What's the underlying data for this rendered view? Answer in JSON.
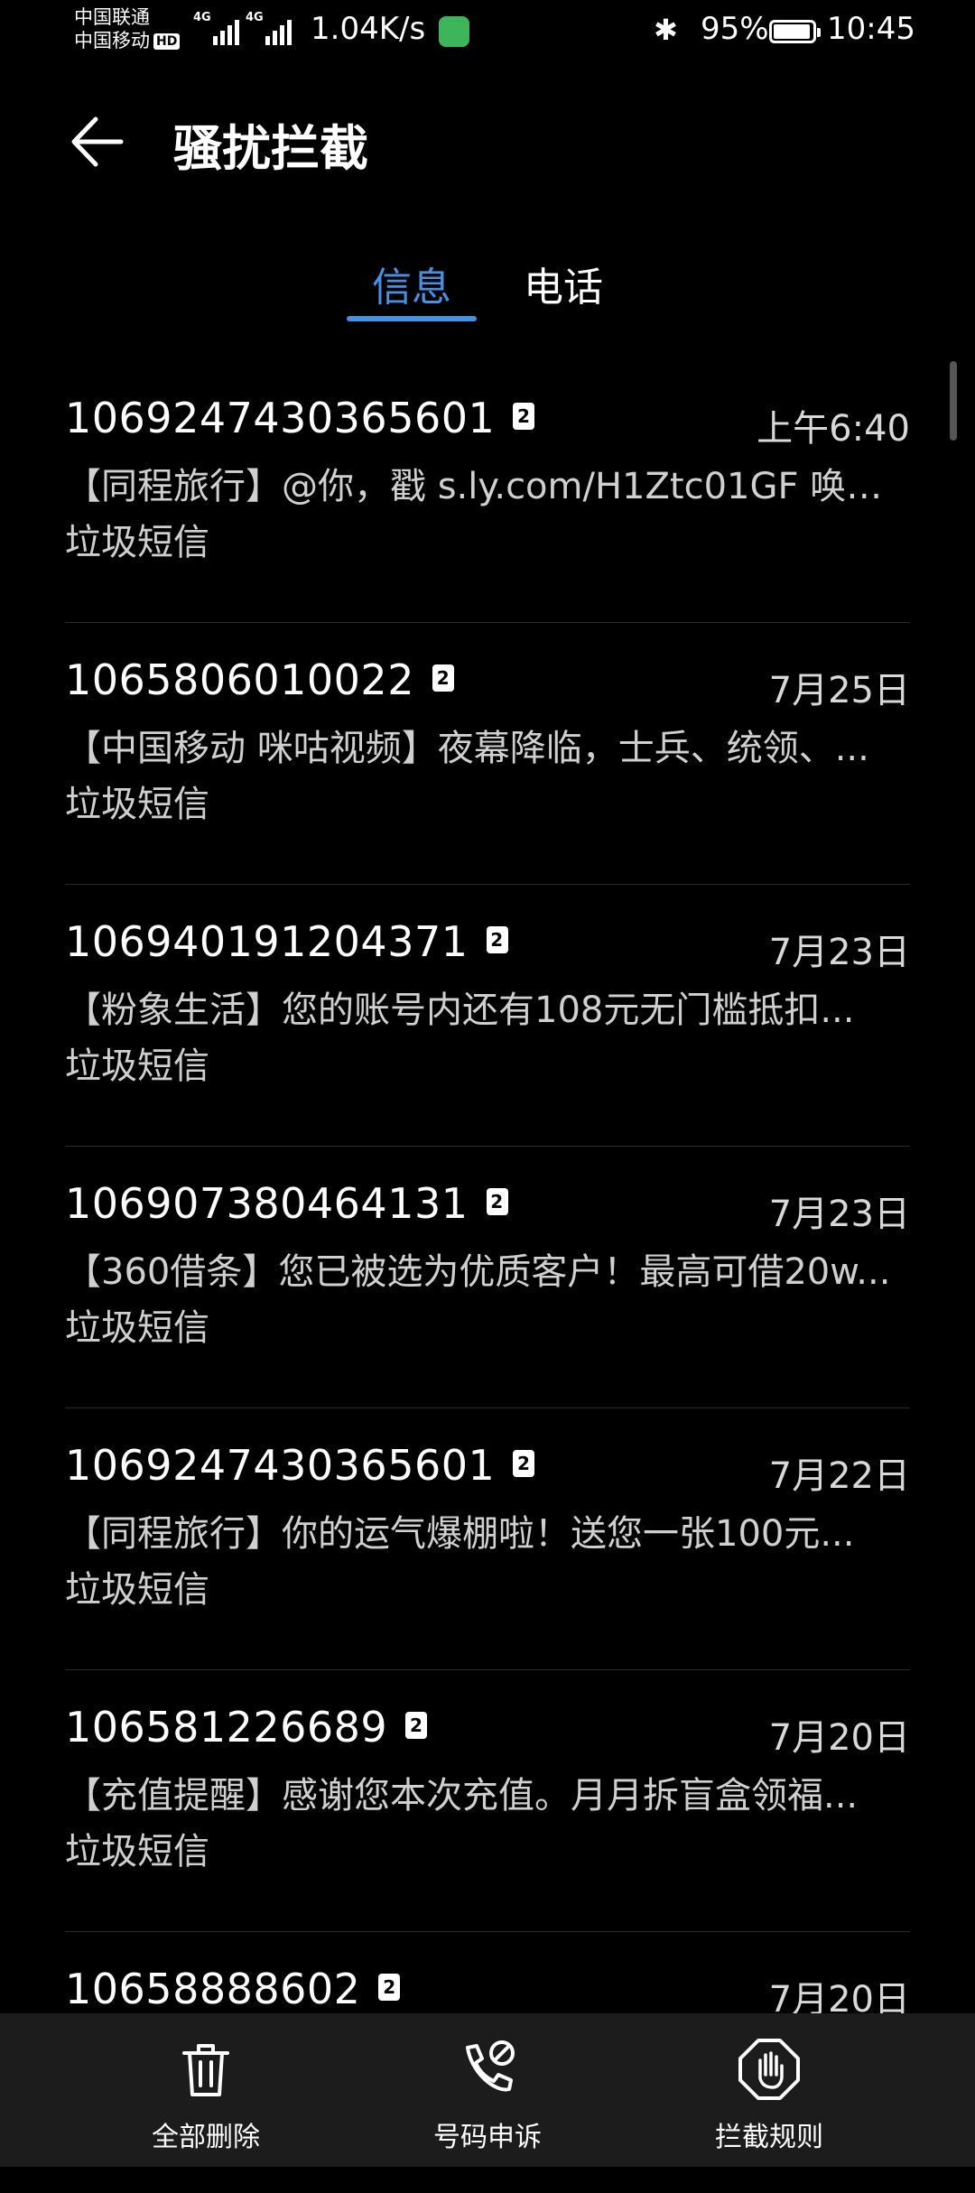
{
  "status": {
    "carrier1": "中国联通",
    "carrier2": "中国移动",
    "hd": "HD",
    "net_label": "4G",
    "speed": "1.04K/s",
    "battery": "95%",
    "battery_level": 0.95,
    "time": "10:45",
    "bluetooth_icon": "bluetooth-icon"
  },
  "header": {
    "title": "骚扰拦截",
    "back_icon": "back-arrow-icon"
  },
  "tabs": [
    {
      "label": "信息",
      "active": true
    },
    {
      "label": "电话",
      "active": false
    }
  ],
  "messages": [
    {
      "number": "1069247430365601",
      "sim": "2",
      "time": "上午6:40",
      "preview": "【同程旅行】@你，戳 s.ly.com/H1Ztc01GF 唤醒...",
      "tag": "垃圾短信"
    },
    {
      "number": "1065806010022",
      "sim": "2",
      "time": "7月25日",
      "preview": "【中国移动 咪咕视频】夜幕降临，士兵、统领、...",
      "tag": "垃圾短信"
    },
    {
      "number": "106940191204371",
      "sim": "2",
      "time": "7月23日",
      "preview": "【粉象生活】您的账号内还有108元无门槛抵扣...",
      "tag": "垃圾短信"
    },
    {
      "number": "106907380464131",
      "sim": "2",
      "time": "7月23日",
      "preview": "【360借条】您已被选为优质客户！最高可借20w...",
      "tag": "垃圾短信"
    },
    {
      "number": "1069247430365601",
      "sim": "2",
      "time": "7月22日",
      "preview": "【同程旅行】你的运气爆棚啦！送您一张100元...",
      "tag": "垃圾短信"
    },
    {
      "number": "106581226689",
      "sim": "2",
      "time": "7月20日",
      "preview": "【充值提醒】感谢您本次充值。月月拆盲盒领福...",
      "tag": "垃圾短信"
    },
    {
      "number": "10658888602",
      "sim": "2",
      "time": "7月20日",
      "preview": "",
      "tag": ""
    }
  ],
  "bottom": {
    "delete_all": "全部删除",
    "number_appeal": "号码申诉",
    "block_rules": "拦截规则"
  },
  "colors": {
    "accent": "#4a90e2",
    "background": "#000000",
    "bottom_bar": "#1c1c1c"
  }
}
